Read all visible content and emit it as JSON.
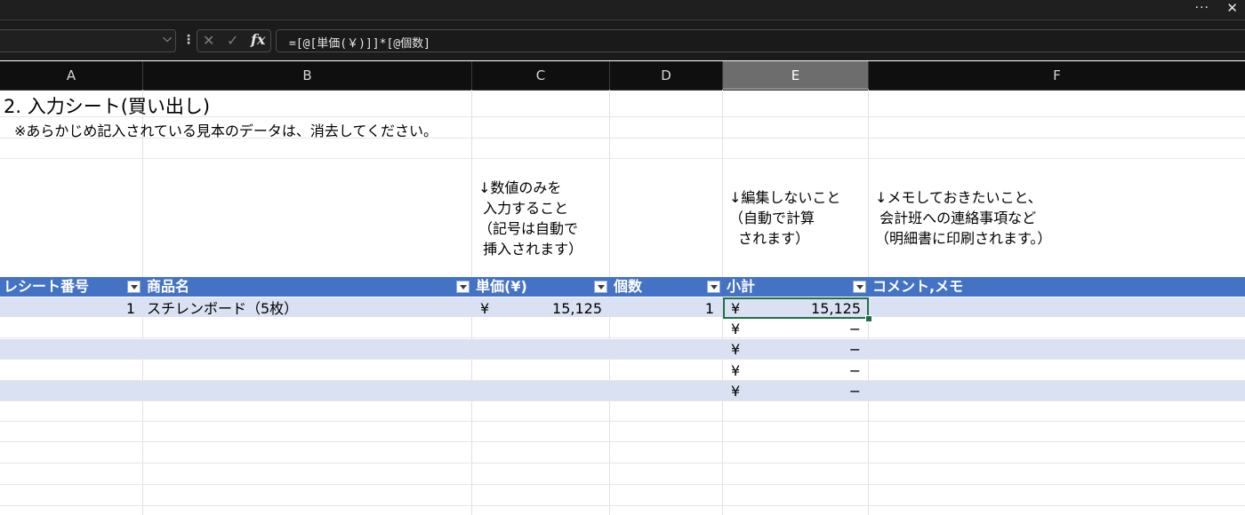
{
  "window": {
    "more_label": "···",
    "close_label": "✕"
  },
  "formula_bar": {
    "namebox_value": "",
    "formula": "=[@[単価(￥)]]*[@個数]"
  },
  "columns": [
    "A",
    "B",
    "C",
    "D",
    "E",
    "F"
  ],
  "selected_column": "E",
  "sheet": {
    "title": "2. 入力シート(買い出し)",
    "note": "※あらかじめ記入されている見本のデータは、消去してください。",
    "instr_price": "↓数値のみを\n 入力すること\n（記号は自動で\n 挿入されます）",
    "instr_subtotal": "↓編集しないこと\n（自動で計算\n  されます）",
    "instr_comment": "↓メモしておきたいこと、\n 会計班への連絡事項など\n（明細書に印刷されます。）"
  },
  "table": {
    "headers": [
      "レシート番号",
      "商品名",
      "単価(¥)",
      "個数",
      "小計",
      "コメント,メモ"
    ],
    "rows": [
      {
        "receipt": "1",
        "item": "スチレンボード（5枚）",
        "price_yen": "¥",
        "price": "15,125",
        "qty": "1",
        "sub_yen": "¥",
        "subtotal": "15,125",
        "comment": ""
      },
      {
        "receipt": "",
        "item": "",
        "price_yen": "",
        "price": "",
        "qty": "",
        "sub_yen": "¥",
        "subtotal": "−",
        "comment": ""
      },
      {
        "receipt": "",
        "item": "",
        "price_yen": "",
        "price": "",
        "qty": "",
        "sub_yen": "¥",
        "subtotal": "−",
        "comment": ""
      },
      {
        "receipt": "",
        "item": "",
        "price_yen": "",
        "price": "",
        "qty": "",
        "sub_yen": "¥",
        "subtotal": "−",
        "comment": ""
      },
      {
        "receipt": "",
        "item": "",
        "price_yen": "",
        "price": "",
        "qty": "",
        "sub_yen": "¥",
        "subtotal": "−",
        "comment": ""
      }
    ]
  },
  "colors": {
    "table_header": "#4472c4",
    "band": "#d9e1f2",
    "selection": "#1f7145"
  }
}
